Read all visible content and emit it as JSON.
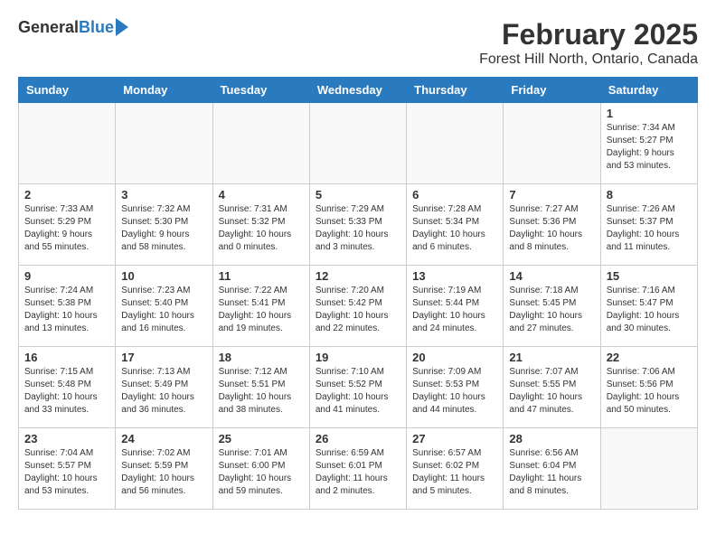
{
  "header": {
    "logo_general": "General",
    "logo_blue": "Blue",
    "month_year": "February 2025",
    "location": "Forest Hill North, Ontario, Canada"
  },
  "days_of_week": [
    "Sunday",
    "Monday",
    "Tuesday",
    "Wednesday",
    "Thursday",
    "Friday",
    "Saturday"
  ],
  "weeks": [
    [
      {
        "day": "",
        "info": ""
      },
      {
        "day": "",
        "info": ""
      },
      {
        "day": "",
        "info": ""
      },
      {
        "day": "",
        "info": ""
      },
      {
        "day": "",
        "info": ""
      },
      {
        "day": "",
        "info": ""
      },
      {
        "day": "1",
        "info": "Sunrise: 7:34 AM\nSunset: 5:27 PM\nDaylight: 9 hours and 53 minutes."
      }
    ],
    [
      {
        "day": "2",
        "info": "Sunrise: 7:33 AM\nSunset: 5:29 PM\nDaylight: 9 hours and 55 minutes."
      },
      {
        "day": "3",
        "info": "Sunrise: 7:32 AM\nSunset: 5:30 PM\nDaylight: 9 hours and 58 minutes."
      },
      {
        "day": "4",
        "info": "Sunrise: 7:31 AM\nSunset: 5:32 PM\nDaylight: 10 hours and 0 minutes."
      },
      {
        "day": "5",
        "info": "Sunrise: 7:29 AM\nSunset: 5:33 PM\nDaylight: 10 hours and 3 minutes."
      },
      {
        "day": "6",
        "info": "Sunrise: 7:28 AM\nSunset: 5:34 PM\nDaylight: 10 hours and 6 minutes."
      },
      {
        "day": "7",
        "info": "Sunrise: 7:27 AM\nSunset: 5:36 PM\nDaylight: 10 hours and 8 minutes."
      },
      {
        "day": "8",
        "info": "Sunrise: 7:26 AM\nSunset: 5:37 PM\nDaylight: 10 hours and 11 minutes."
      }
    ],
    [
      {
        "day": "9",
        "info": "Sunrise: 7:24 AM\nSunset: 5:38 PM\nDaylight: 10 hours and 13 minutes."
      },
      {
        "day": "10",
        "info": "Sunrise: 7:23 AM\nSunset: 5:40 PM\nDaylight: 10 hours and 16 minutes."
      },
      {
        "day": "11",
        "info": "Sunrise: 7:22 AM\nSunset: 5:41 PM\nDaylight: 10 hours and 19 minutes."
      },
      {
        "day": "12",
        "info": "Sunrise: 7:20 AM\nSunset: 5:42 PM\nDaylight: 10 hours and 22 minutes."
      },
      {
        "day": "13",
        "info": "Sunrise: 7:19 AM\nSunset: 5:44 PM\nDaylight: 10 hours and 24 minutes."
      },
      {
        "day": "14",
        "info": "Sunrise: 7:18 AM\nSunset: 5:45 PM\nDaylight: 10 hours and 27 minutes."
      },
      {
        "day": "15",
        "info": "Sunrise: 7:16 AM\nSunset: 5:47 PM\nDaylight: 10 hours and 30 minutes."
      }
    ],
    [
      {
        "day": "16",
        "info": "Sunrise: 7:15 AM\nSunset: 5:48 PM\nDaylight: 10 hours and 33 minutes."
      },
      {
        "day": "17",
        "info": "Sunrise: 7:13 AM\nSunset: 5:49 PM\nDaylight: 10 hours and 36 minutes."
      },
      {
        "day": "18",
        "info": "Sunrise: 7:12 AM\nSunset: 5:51 PM\nDaylight: 10 hours and 38 minutes."
      },
      {
        "day": "19",
        "info": "Sunrise: 7:10 AM\nSunset: 5:52 PM\nDaylight: 10 hours and 41 minutes."
      },
      {
        "day": "20",
        "info": "Sunrise: 7:09 AM\nSunset: 5:53 PM\nDaylight: 10 hours and 44 minutes."
      },
      {
        "day": "21",
        "info": "Sunrise: 7:07 AM\nSunset: 5:55 PM\nDaylight: 10 hours and 47 minutes."
      },
      {
        "day": "22",
        "info": "Sunrise: 7:06 AM\nSunset: 5:56 PM\nDaylight: 10 hours and 50 minutes."
      }
    ],
    [
      {
        "day": "23",
        "info": "Sunrise: 7:04 AM\nSunset: 5:57 PM\nDaylight: 10 hours and 53 minutes."
      },
      {
        "day": "24",
        "info": "Sunrise: 7:02 AM\nSunset: 5:59 PM\nDaylight: 10 hours and 56 minutes."
      },
      {
        "day": "25",
        "info": "Sunrise: 7:01 AM\nSunset: 6:00 PM\nDaylight: 10 hours and 59 minutes."
      },
      {
        "day": "26",
        "info": "Sunrise: 6:59 AM\nSunset: 6:01 PM\nDaylight: 11 hours and 2 minutes."
      },
      {
        "day": "27",
        "info": "Sunrise: 6:57 AM\nSunset: 6:02 PM\nDaylight: 11 hours and 5 minutes."
      },
      {
        "day": "28",
        "info": "Sunrise: 6:56 AM\nSunset: 6:04 PM\nDaylight: 11 hours and 8 minutes."
      },
      {
        "day": "",
        "info": ""
      }
    ]
  ]
}
